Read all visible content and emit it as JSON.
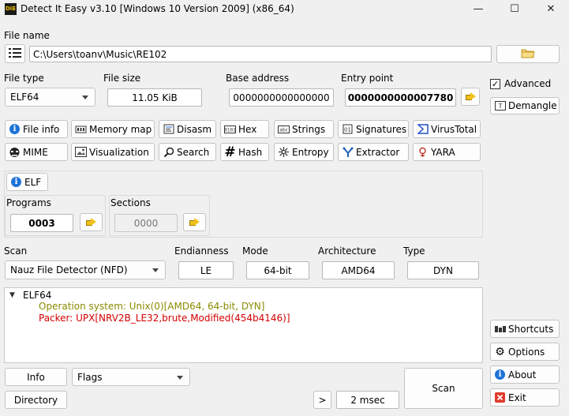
{
  "window": {
    "title": "Detect It Easy v3.10 [Windows 10 Version 2009] (x86_64)",
    "logo_text": "DiE",
    "minimize": "—",
    "maximize": "☐",
    "close": "✕"
  },
  "file": {
    "label": "File name",
    "path": "C:\\Users\\toanv\\Music\\RE102"
  },
  "fields": {
    "file_type_label": "File type",
    "file_type": "ELF64",
    "file_size_label": "File size",
    "file_size": "11.05 KiB",
    "base_address_label": "Base address",
    "base_address": "0000000000000000",
    "entry_point_label": "Entry point",
    "entry_point": "0000000000007780"
  },
  "tools_row1": [
    "File info",
    "Memory map",
    "Disasm",
    "Hex",
    "Strings",
    "Signatures",
    "VirusTotal"
  ],
  "tools_row2": [
    "MIME",
    "Visualization",
    "Search",
    "Hash",
    "Entropy",
    "Extractor",
    "YARA"
  ],
  "elf_panel": {
    "elf_button": "ELF",
    "programs_label": "Programs",
    "programs_value": "0003",
    "sections_label": "Sections",
    "sections_value": "0000"
  },
  "scan_options": {
    "scan_label": "Scan",
    "scan_engine": "Nauz File Detector (NFD)",
    "endianness_label": "Endianness",
    "endianness": "LE",
    "mode_label": "Mode",
    "mode": "64-bit",
    "architecture_label": "Architecture",
    "architecture": "AMD64",
    "type_label": "Type",
    "type": "DYN"
  },
  "results": {
    "root": "ELF64",
    "os_line": "Operation system: Unix(0)[AMD64, 64-bit, DYN]",
    "packer_line": "Packer: UPX[NRV2B_LE32,brute,Modified(454b4146)]",
    "colors": {
      "os": "#8b8b00",
      "packer": "#d40000"
    }
  },
  "bottom": {
    "info_button": "Info",
    "flags_combo": "Flags",
    "directory_button": "Directory",
    "expand_button": ">",
    "elapsed": "2 msec",
    "scan_button": "Scan"
  },
  "side": {
    "advanced_label": "Advanced",
    "advanced_checked": true,
    "demangle_button": "Demangle",
    "shortcuts_button": "Shortcuts",
    "options_button": "Options",
    "about_button": "About",
    "exit_button": "Exit"
  }
}
